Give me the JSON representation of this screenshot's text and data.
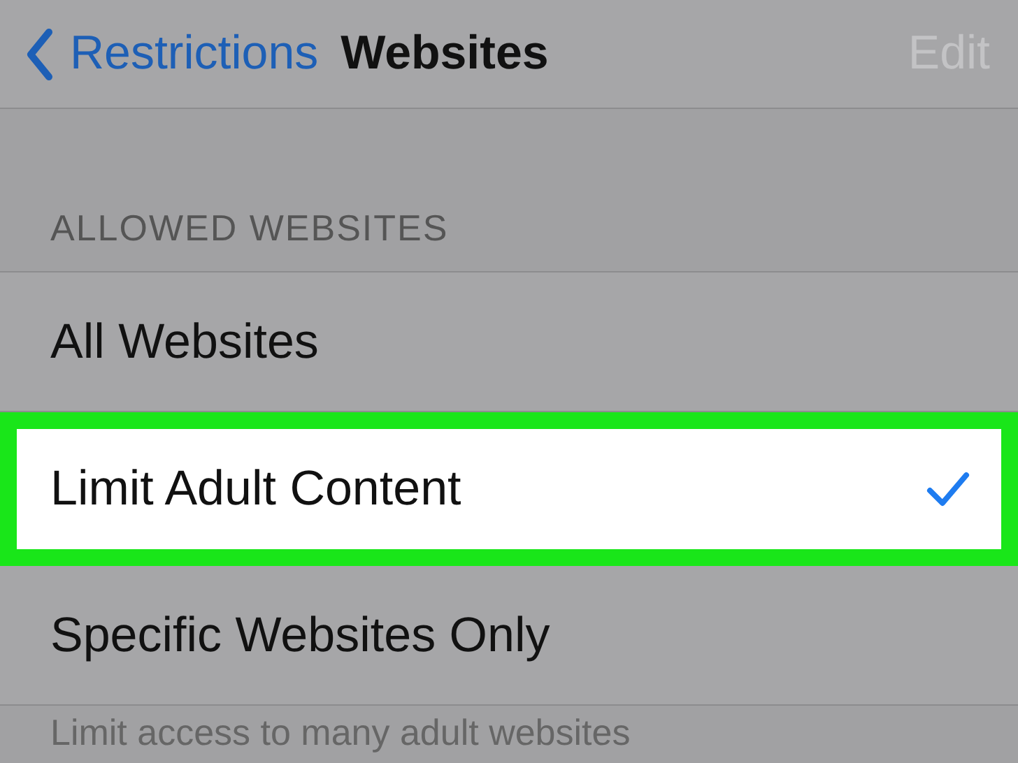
{
  "nav": {
    "back": "Restrictions",
    "title": "Websites",
    "action": "Edit",
    "action_disabled": true
  },
  "section": {
    "header": "ALLOWED WEBSITES",
    "rows": [
      {
        "label": "All Websites",
        "selected": false,
        "highlighted": false
      },
      {
        "label": "Limit Adult Content",
        "selected": true,
        "highlighted": true
      },
      {
        "label": "Specific Websites Only",
        "selected": false,
        "highlighted": false
      }
    ],
    "footer": "Limit access to many adult websites"
  }
}
